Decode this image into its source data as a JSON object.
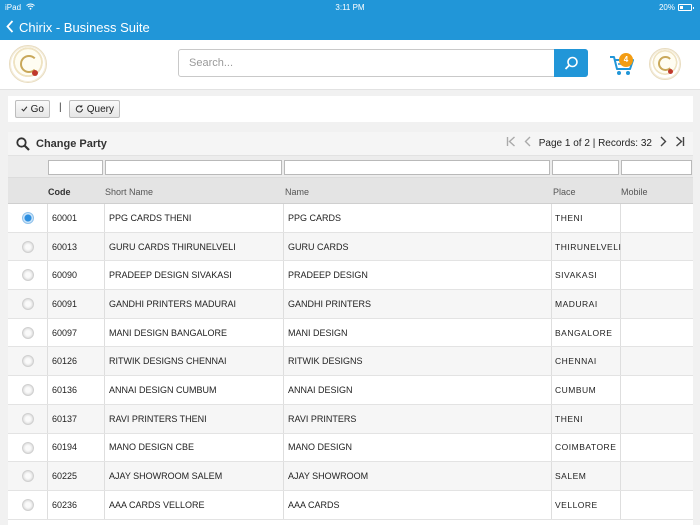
{
  "status_bar": {
    "device": "iPad",
    "time": "3:11 PM",
    "battery": "20%"
  },
  "nav": {
    "back_icon": "chevron-left-icon",
    "title": "Chirix - Business Suite"
  },
  "header": {
    "search": {
      "placeholder": "Search..."
    },
    "cart": {
      "badge": "4"
    }
  },
  "toolbar": {
    "go_label": "Go",
    "separator": "|",
    "query_label": "Query"
  },
  "grid": {
    "title": "Change Party",
    "pager": {
      "text": "Page 1 of 2 | Records: 32"
    },
    "columns": {
      "code": "Code",
      "short_name": "Short Name",
      "name": "Name",
      "place": "Place",
      "mobile": "Mobile"
    },
    "rows": [
      {
        "selected": true,
        "code": "60001",
        "short_name": "PPG CARDS THENI",
        "name": "PPG CARDS",
        "place": "THENI",
        "mobile": ""
      },
      {
        "selected": false,
        "code": "60013",
        "short_name": "GURU CARDS THIRUNELVELI",
        "name": "GURU CARDS",
        "place": "THIRUNELVELI",
        "mobile": ""
      },
      {
        "selected": false,
        "code": "60090",
        "short_name": "PRADEEP DESIGN SIVAKASI",
        "name": "PRADEEP DESIGN",
        "place": "SIVAKASI",
        "mobile": ""
      },
      {
        "selected": false,
        "code": "60091",
        "short_name": "GANDHI PRINTERS MADURAI",
        "name": "GANDHI PRINTERS",
        "place": "MADURAI",
        "mobile": ""
      },
      {
        "selected": false,
        "code": "60097",
        "short_name": "MANI DESIGN BANGALORE",
        "name": "MANI DESIGN",
        "place": "BANGALORE",
        "mobile": ""
      },
      {
        "selected": false,
        "code": "60126",
        "short_name": "RITWIK DESIGNS CHENNAI",
        "name": "RITWIK DESIGNS",
        "place": "CHENNAI",
        "mobile": ""
      },
      {
        "selected": false,
        "code": "60136",
        "short_name": "ANNAI DESIGN CUMBUM",
        "name": "ANNAI DESIGN",
        "place": "CUMBUM",
        "mobile": ""
      },
      {
        "selected": false,
        "code": "60137",
        "short_name": "RAVI PRINTERS THENI",
        "name": "RAVI PRINTERS",
        "place": "THENI",
        "mobile": ""
      },
      {
        "selected": false,
        "code": "60194",
        "short_name": "MANO DESIGN CBE",
        "name": "MANO DESIGN",
        "place": "COIMBATORE",
        "mobile": ""
      },
      {
        "selected": false,
        "code": "60225",
        "short_name": "AJAY SHOWROOM SALEM",
        "name": "AJAY SHOWROOM",
        "place": "SALEM",
        "mobile": ""
      },
      {
        "selected": false,
        "code": "60236",
        "short_name": "AAA CARDS VELLORE",
        "name": "AAA CARDS",
        "place": "VELLORE",
        "mobile": ""
      }
    ]
  },
  "colors": {
    "brand_blue": "#2196d8",
    "badge_orange": "#f39c12",
    "selected_radio": "#2d8fe0"
  }
}
